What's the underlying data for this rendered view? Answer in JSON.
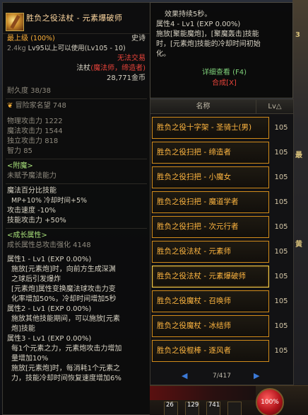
{
  "item": {
    "name": "胜负之役法杖 - 元素爆破师",
    "rarity": "最上级",
    "rarity_pct": "(100%)",
    "grade": "史诗",
    "weight": "2.4kg",
    "level_req": "Lv95以上可以使用(Lv105 - 10)",
    "trade": "无法交易",
    "type_label": "法杖",
    "classes": "(魔法师，缔造者)",
    "price": "28,771金币",
    "durability": "耐久度 38/38",
    "fame": "冒险家名望 748",
    "stats": [
      {
        "label": "物理攻击力",
        "value": "1222"
      },
      {
        "label": "魔法攻击力",
        "value": "1544"
      },
      {
        "label": "独立攻击力",
        "value": "818"
      },
      {
        "label": "智力",
        "value": "85"
      }
    ],
    "enchant_title": "<附魔>",
    "enchant_text": "未赋予魔法能力",
    "magic_title": "魔法百分比技能",
    "magic_lines": [
      "MP+10% 冷却时间+5%"
    ],
    "speed_lines": [
      "攻击速度 -10%",
      "技能攻击力 +50%"
    ],
    "growth_title": "<成长属性>",
    "growth_total": "成长属性总攻击强化 4148",
    "attr1_title": "属性1 - Lv1 (EXP 0.00%)",
    "attr1_lines": [
      "施放[元素炮]时，向前方生成深渊",
      "之球后引发爆炸",
      "[元素炮]属性变换魔法球攻击力变",
      "化率增加50%，冷却时间增加5秒"
    ],
    "attr2_title": "属性2 - Lv1 (EXP 0.00%)",
    "attr2_lines": [
      "施放其他技能期间，可以施放[元素",
      "炮]技能"
    ],
    "attr3_title": "属性3 - Lv1 (EXP 0.00%)",
    "attr3_lines": [
      "每1个元素之力，元素炮攻击力增加",
      "量增加10%",
      "施放[元素炮]时，每消耗1个元素之",
      "力，技能冷却时间恢复速度增加6%"
    ]
  },
  "effect": {
    "line1": "效果持续5秒。",
    "attr4_title": "属性4 - Lv1 (EXP 0.00%)",
    "attr4_lines": [
      "施放[聚能魔炮]，[聚魔轰击]技能",
      "时，[元素炮]技能的冷却时间初始",
      "化。"
    ],
    "detail_link": "详细查看 (F4)",
    "synth_link": "合成[X]"
  },
  "list": {
    "col_name": "名称",
    "col_lv": "Lv△",
    "rows": [
      {
        "name": "胜负之役十字架 - 圣骑士(男)",
        "lv": "105"
      },
      {
        "name": "胜负之役扫把 - 缔造者",
        "lv": "105"
      },
      {
        "name": "胜负之役扫把 - 小魔女",
        "lv": "105"
      },
      {
        "name": "胜负之役扫把 - 魔道学者",
        "lv": "105"
      },
      {
        "name": "胜负之役扫把 - 次元行者",
        "lv": "105"
      },
      {
        "name": "胜负之役法杖 - 元素师",
        "lv": "105"
      },
      {
        "name": "胜负之役法杖 - 元素爆破师",
        "lv": "105"
      },
      {
        "name": "胜负之役魔杖 - 召唤师",
        "lv": "105"
      },
      {
        "name": "胜负之役魔杖 - 冰结师",
        "lv": "105"
      },
      {
        "name": "胜负之役棍棒 - 逐风者",
        "lv": "105"
      }
    ],
    "page": "7/417"
  },
  "hud": {
    "slots": [
      "26",
      "129",
      "741"
    ],
    "hp": "100%"
  },
  "side_glyphs": [
    "3",
    "最",
    "黄"
  ]
}
